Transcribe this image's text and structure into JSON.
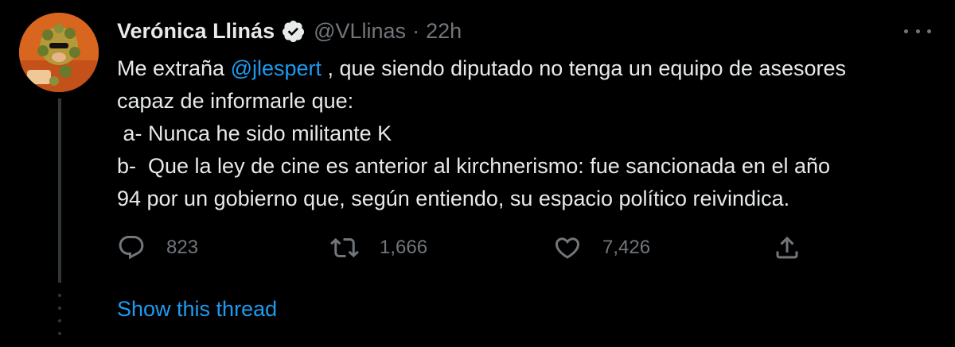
{
  "tweet": {
    "author_name": "Verónica Llinás",
    "handle": "@VLlinas",
    "separator": "·",
    "time": "22h",
    "body": {
      "line1_prefix": "Me extraña ",
      "mention": "@jlespert",
      "line1_suffix": " , que siendo diputado no tenga un equipo de asesores",
      "line2": "capaz de informarle que:",
      "line3": " a- Nunca he sido militante K",
      "line4": "b-  Que la ley de cine es anterior al kirchnerismo: fue sancionada en el año",
      "line5": "94 por un gobierno que, según entiendo, su espacio político reivindica."
    },
    "actions": {
      "replies": "823",
      "retweets": "1,666",
      "likes": "7,426"
    },
    "show_thread": "Show this thread"
  },
  "icons": {
    "verified": "verified-badge-icon",
    "more": "more-options-icon",
    "reply": "reply-icon",
    "retweet": "retweet-icon",
    "like": "heart-icon",
    "share": "share-icon"
  },
  "colors": {
    "background": "#000000",
    "text": "#e7e9ea",
    "secondary": "#71767b",
    "accent": "#1d9bf0",
    "avatar_bg": "#d9661f"
  }
}
